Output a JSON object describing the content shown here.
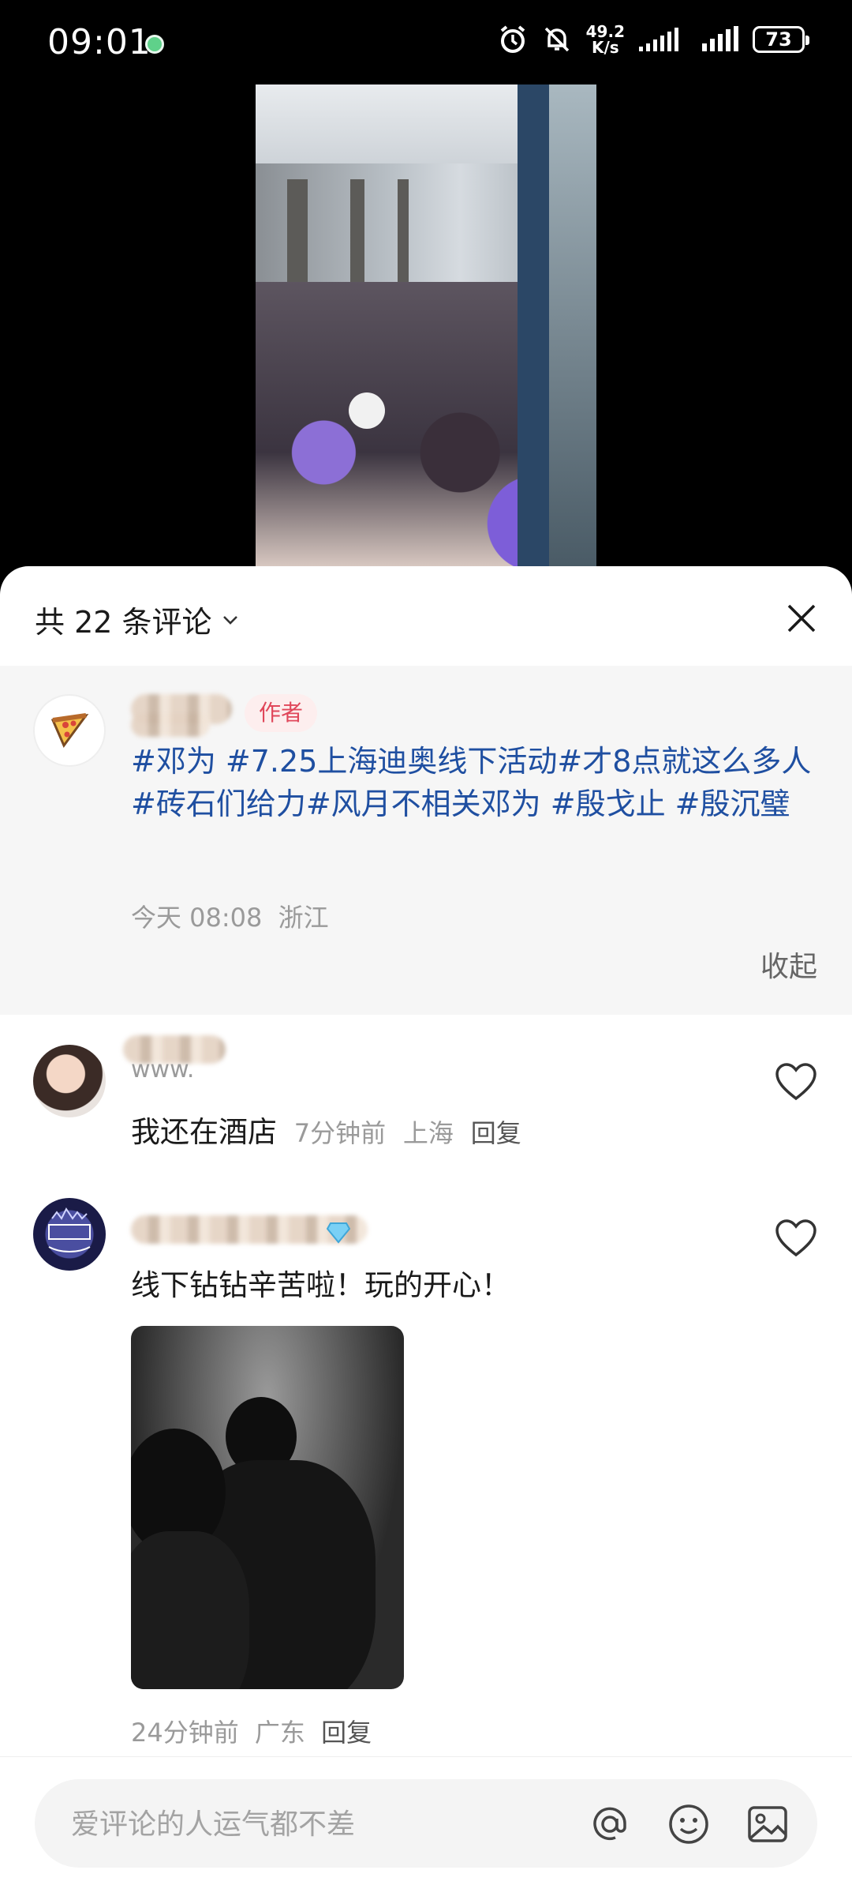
{
  "status_bar": {
    "time": "09:01",
    "net_speed_value": "49.2",
    "net_speed_unit": "K/s",
    "battery": "73"
  },
  "sheet": {
    "comment_count": "共 22 条评论",
    "collapse_label": "收起"
  },
  "author_comment": {
    "badge": "作者",
    "text": "#邓为 #7.25上海迪奥线下活动#才8点就这么多人#砖石们给力#风月不相关邓为 #殷戈止 #殷沉璧",
    "time": "今天 08:08",
    "location": "浙江"
  },
  "comments": [
    {
      "name": "www.",
      "text": "我还在酒店",
      "time": "7分钟前",
      "location": "上海",
      "reply": "回复"
    },
    {
      "text": "线下钻钻辛苦啦！玩的开心！",
      "time": "24分钟前",
      "location": "广东",
      "reply": "回复"
    }
  ],
  "input": {
    "placeholder": "爱评论的人运气都不差"
  },
  "icons": [
    "alarm-icon",
    "mute-icon",
    "signal-icon",
    "chevron-down-icon",
    "close-icon",
    "heart-icon",
    "at-icon",
    "emoji-icon",
    "image-icon"
  ]
}
